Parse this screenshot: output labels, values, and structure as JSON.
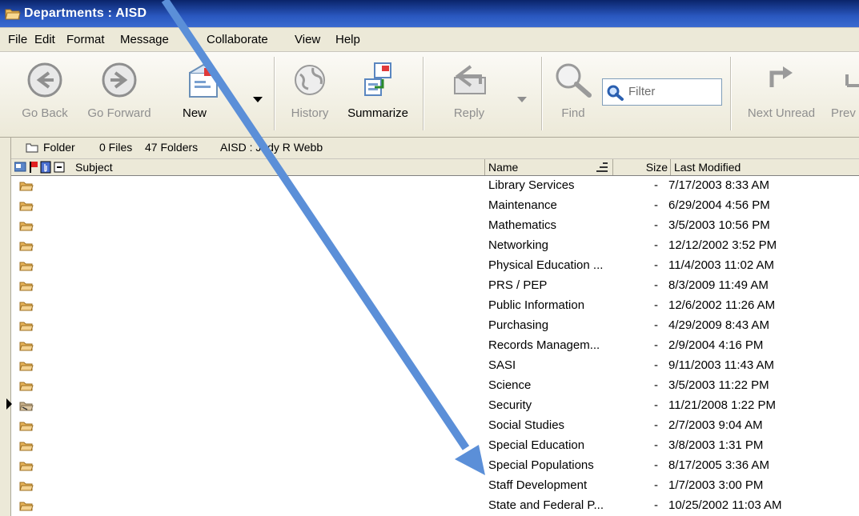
{
  "window": {
    "title": "Departments : AISD"
  },
  "menu": [
    "File",
    "Edit",
    "Format",
    "Message",
    "Collaborate",
    "View",
    "Help"
  ],
  "toolbar": {
    "go_back": "Go Back",
    "go_forward": "Go Forward",
    "new": "New",
    "history": "History",
    "summarize": "Summarize",
    "reply": "Reply",
    "find": "Find",
    "filter_placeholder": "Filter",
    "next_unread": "Next Unread",
    "prev": "Prev"
  },
  "info": {
    "folder": "Folder",
    "files": "0 Files",
    "folders": "47 Folders",
    "path": "AISD : Judy R Webb"
  },
  "columns": {
    "subject": "Subject",
    "name": "Name",
    "size": "Size",
    "modified": "Last Modified"
  },
  "rows": [
    {
      "name": "Library Services",
      "size": "-",
      "modified": "7/17/2003  8:33 AM"
    },
    {
      "name": "Maintenance",
      "size": "-",
      "modified": "6/29/2004  4:56 PM"
    },
    {
      "name": "Mathematics",
      "size": "-",
      "modified": "3/5/2003  10:56 PM"
    },
    {
      "name": "Networking",
      "size": "-",
      "modified": "12/12/2002  3:52 PM"
    },
    {
      "name": "Physical Education ...",
      "size": "-",
      "modified": "11/4/2003  11:02 AM"
    },
    {
      "name": "PRS / PEP",
      "size": "-",
      "modified": "8/3/2009  11:49 AM"
    },
    {
      "name": "Public Information",
      "size": "-",
      "modified": "12/6/2002  11:26 AM"
    },
    {
      "name": "Purchasing",
      "size": "-",
      "modified": "4/29/2009  8:43 AM"
    },
    {
      "name": "Records Managem...",
      "size": "-",
      "modified": "2/9/2004  4:16 PM"
    },
    {
      "name": "SASI",
      "size": "-",
      "modified": "9/11/2003  11:43 AM"
    },
    {
      "name": "Science",
      "size": "-",
      "modified": "3/5/2003  11:22 PM"
    },
    {
      "name": "Security",
      "size": "-",
      "modified": "11/21/2008  1:22 PM"
    },
    {
      "name": "Social Studies",
      "size": "-",
      "modified": "2/7/2003  9:04 AM"
    },
    {
      "name": "Special Education",
      "size": "-",
      "modified": "3/8/2003  1:31 PM"
    },
    {
      "name": "Special Populations",
      "size": "-",
      "modified": "8/17/2005  3:36 AM"
    },
    {
      "name": "Staff Development",
      "size": "-",
      "modified": "1/7/2003  3:00 PM"
    },
    {
      "name": "State and Federal P...",
      "size": "-",
      "modified": "10/25/2002  11:03 AM"
    }
  ],
  "colors": {
    "annotation_arrow": "#5b8fd8",
    "titlebar": "#0a246a",
    "folder": "#e6b35a"
  }
}
